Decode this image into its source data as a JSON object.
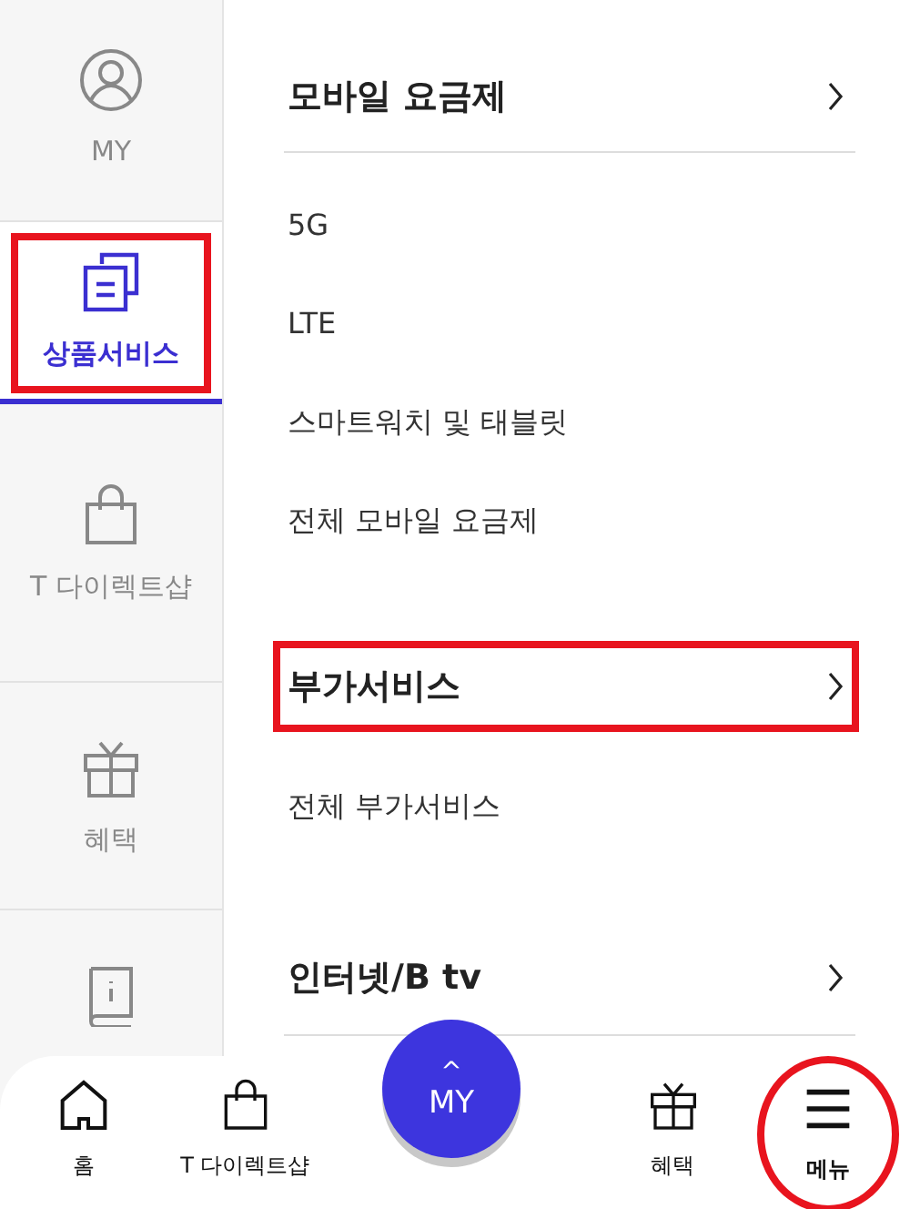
{
  "sidebar": {
    "items": [
      {
        "label": "MY",
        "kind": "person",
        "selected": false,
        "highlighted": false
      },
      {
        "label": "상품서비스",
        "kind": "documents",
        "selected": true,
        "highlighted": true
      },
      {
        "label": "T 다이렉트샵",
        "kind": "bag",
        "selected": false,
        "highlighted": false
      },
      {
        "label": "혜택",
        "kind": "gift",
        "selected": false,
        "highlighted": false
      },
      {
        "kind": "book",
        "selected": false,
        "highlighted": false
      }
    ]
  },
  "sections": [
    {
      "title": "모바일 요금제",
      "highlighted": false,
      "links": [
        "5G",
        "LTE",
        "스마트워치 및 태블릿",
        "전체 모바일 요금제"
      ]
    },
    {
      "title": "부가서비스",
      "highlighted": true,
      "links": [
        "전체 부가서비스"
      ]
    },
    {
      "title": "인터넷/B tv",
      "highlighted": false
    }
  ],
  "fab": {
    "caret": "^",
    "label": "MY"
  },
  "bottom_nav": [
    {
      "label": "홈",
      "kind": "home",
      "highlighted": false
    },
    {
      "label": "T 다이렉트샵",
      "kind": "bag",
      "highlighted": false
    },
    {
      "label": "혜택",
      "kind": "gift",
      "highlighted": false
    },
    {
      "label": "메뉴",
      "kind": "menu",
      "highlighted": true
    }
  ]
}
